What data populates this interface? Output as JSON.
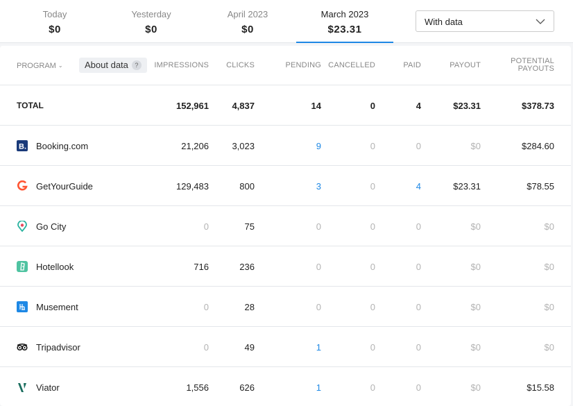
{
  "tabs": [
    {
      "label": "Today",
      "value": "$0"
    },
    {
      "label": "Yesterday",
      "value": "$0"
    },
    {
      "label": "April 2023",
      "value": "$0"
    },
    {
      "label": "March 2023",
      "value": "$23.31"
    }
  ],
  "filter": {
    "value": "With data"
  },
  "header": {
    "program": "PROGRAM",
    "about_data": "About data",
    "about_q": "?",
    "impressions": "IMPRESSIONS",
    "clicks": "CLICKS",
    "pending": "PENDING",
    "cancelled": "CANCELLED",
    "paid": "PAID",
    "payout": "PAYOUT",
    "potential_1": "POTENTIAL",
    "potential_2": "PAYOUTS"
  },
  "total": {
    "label": "TOTAL",
    "impressions": "152,961",
    "clicks": "4,837",
    "pending": "14",
    "cancelled": "0",
    "paid": "4",
    "payout": "$23.31",
    "potential": "$378.73"
  },
  "rows": [
    {
      "name": "Booking.com",
      "icon": "booking-icon",
      "impressions": "21,206",
      "clicks": "3,023",
      "pending": "9",
      "cancelled": "0",
      "paid": "0",
      "payout": "$0",
      "potential": "$284.60"
    },
    {
      "name": "GetYourGuide",
      "icon": "getyourguide-icon",
      "impressions": "129,483",
      "clicks": "800",
      "pending": "3",
      "cancelled": "0",
      "paid": "4",
      "payout": "$23.31",
      "potential": "$78.55"
    },
    {
      "name": "Go City",
      "icon": "gocity-icon",
      "impressions": "0",
      "clicks": "75",
      "pending": "0",
      "cancelled": "0",
      "paid": "0",
      "payout": "$0",
      "potential": "$0"
    },
    {
      "name": "Hotellook",
      "icon": "hotellook-icon",
      "impressions": "716",
      "clicks": "236",
      "pending": "0",
      "cancelled": "0",
      "paid": "0",
      "payout": "$0",
      "potential": "$0"
    },
    {
      "name": "Musement",
      "icon": "musement-icon",
      "impressions": "0",
      "clicks": "28",
      "pending": "0",
      "cancelled": "0",
      "paid": "0",
      "payout": "$0",
      "potential": "$0"
    },
    {
      "name": "Tripadvisor",
      "icon": "tripadvisor-icon",
      "impressions": "0",
      "clicks": "49",
      "pending": "1",
      "cancelled": "0",
      "paid": "0",
      "payout": "$0",
      "potential": "$0"
    },
    {
      "name": "Viator",
      "icon": "viator-icon",
      "impressions": "1,556",
      "clicks": "626",
      "pending": "1",
      "cancelled": "0",
      "paid": "0",
      "payout": "$0",
      "potential": "$15.58"
    }
  ],
  "colors": {
    "accent": "#1e88e5",
    "muted": "#b3b3b3"
  }
}
